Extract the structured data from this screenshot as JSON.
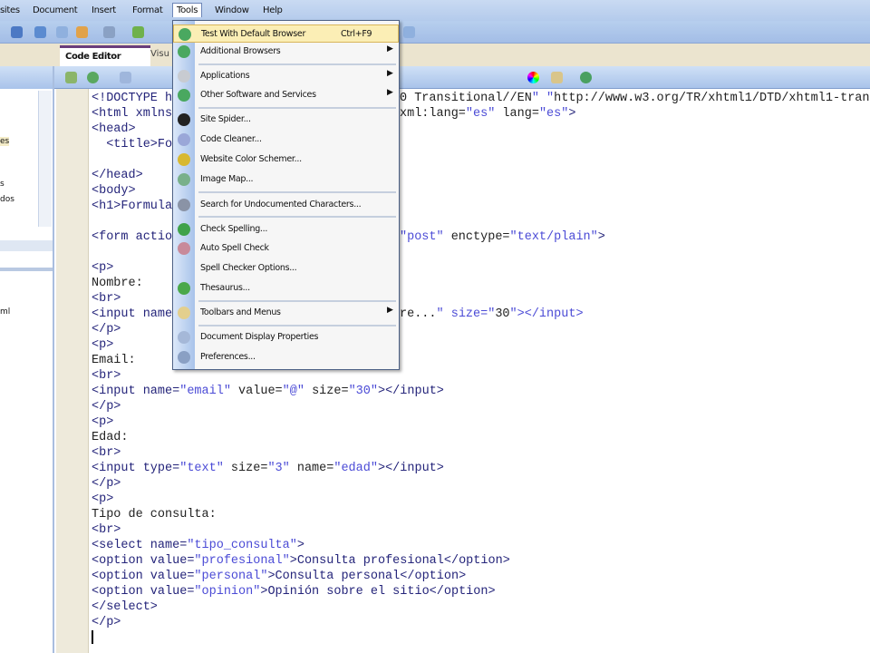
{
  "menubar": {
    "items": [
      "sites",
      "Document",
      "Insert",
      "Format",
      "Tools",
      "Window",
      "Help"
    ]
  },
  "tabs": {
    "code": "Code Editor",
    "visual": "Visu"
  },
  "left_panel": {
    "fragments": [
      "es",
      "s",
      "dos",
      "ml"
    ]
  },
  "tools_menu": {
    "items": [
      {
        "label": "Test With Default Browser",
        "shortcut": "Ctrl+F9",
        "icon": "globe-icon",
        "highlighted": true
      },
      {
        "label": "Additional Browsers",
        "submenu": true,
        "icon": "globe-icon"
      },
      {
        "label": "Applications",
        "submenu": true,
        "icon": "applications-icon"
      },
      {
        "label": "Other Software and Services",
        "submenu": true,
        "icon": "globe-icon"
      },
      {
        "label": "Site Spider...",
        "icon": "spider-icon"
      },
      {
        "label": "Code Cleaner...",
        "icon": "code-cleaner-icon"
      },
      {
        "label": "Website Color Schemer...",
        "icon": "color-schemer-icon"
      },
      {
        "label": "Image Map...",
        "icon": "image-map-icon"
      },
      {
        "label": "Search for Undocumented Characters...",
        "icon": "search-characters-icon"
      },
      {
        "label": "Check Spelling...",
        "icon": "check-spelling-icon"
      },
      {
        "label": "Auto Spell Check",
        "icon": "auto-spell-icon"
      },
      {
        "label": "Spell Checker Options..."
      },
      {
        "label": "Thesaurus...",
        "icon": "thesaurus-icon"
      },
      {
        "label": "Toolbars and Menus",
        "submenu": true,
        "icon": "toolbars-icon"
      },
      {
        "label": "Document Display Properties",
        "icon": "document-display-icon"
      },
      {
        "label": "Preferences...",
        "icon": "preferences-icon"
      }
    ]
  },
  "code": {
    "lines": [
      {
        "l": "<!DOCTYPE h",
        "r": "0 Transitional//EN\" \"http://www.w3.org/TR/xhtml1/DTD/xhtml1-trans"
      },
      {
        "l": "<html xmlns",
        "r": "xml:lang=\"es\" lang=\"es\">"
      },
      {
        "l": "<head>"
      },
      {
        "l": "  <title>Fo"
      },
      {
        "l": ""
      },
      {
        "l": "</head>"
      },
      {
        "l": "<body>"
      },
      {
        "l": "<h1>Formula"
      },
      {
        "l": ""
      },
      {
        "l": "<form actio",
        "r": "\"post\" enctype=\"text/plain\">"
      },
      {
        "l": ""
      },
      {
        "l": "<p>"
      },
      {
        "l": "Nombre:"
      },
      {
        "l": "<br>"
      },
      {
        "l": "<input name",
        "r": "re...\" size=\"30\"></input>"
      },
      {
        "l": "</p>"
      },
      {
        "l": "<p>"
      },
      {
        "l": "Email:"
      },
      {
        "l": "<br>"
      },
      {
        "l": "<input name=\"email\" value=\"@\" size=\"30\"></input>"
      },
      {
        "l": "</p>"
      },
      {
        "l": "<p>"
      },
      {
        "l": "Edad:"
      },
      {
        "l": "<br>"
      },
      {
        "l": "<input type=\"text\" size=\"3\" name=\"edad\"></input>"
      },
      {
        "l": "</p>"
      },
      {
        "l": "<p>"
      },
      {
        "l": "Tipo de consulta:"
      },
      {
        "l": "<br>"
      },
      {
        "l": "<select name=\"tipo_consulta\">"
      },
      {
        "l": "<option value=\"profesional\">Consulta profesional</option>"
      },
      {
        "l": "<option value=\"personal\">Consulta personal</option>"
      },
      {
        "l": "<option value=\"opinion\">Opinión sobre el sitio</option>"
      },
      {
        "l": "</select>"
      },
      {
        "l": "</p>"
      }
    ]
  },
  "colors": {
    "menu_highlight": "#fbeeb5",
    "tag": "#24247a",
    "string": "#4b4bd6"
  }
}
